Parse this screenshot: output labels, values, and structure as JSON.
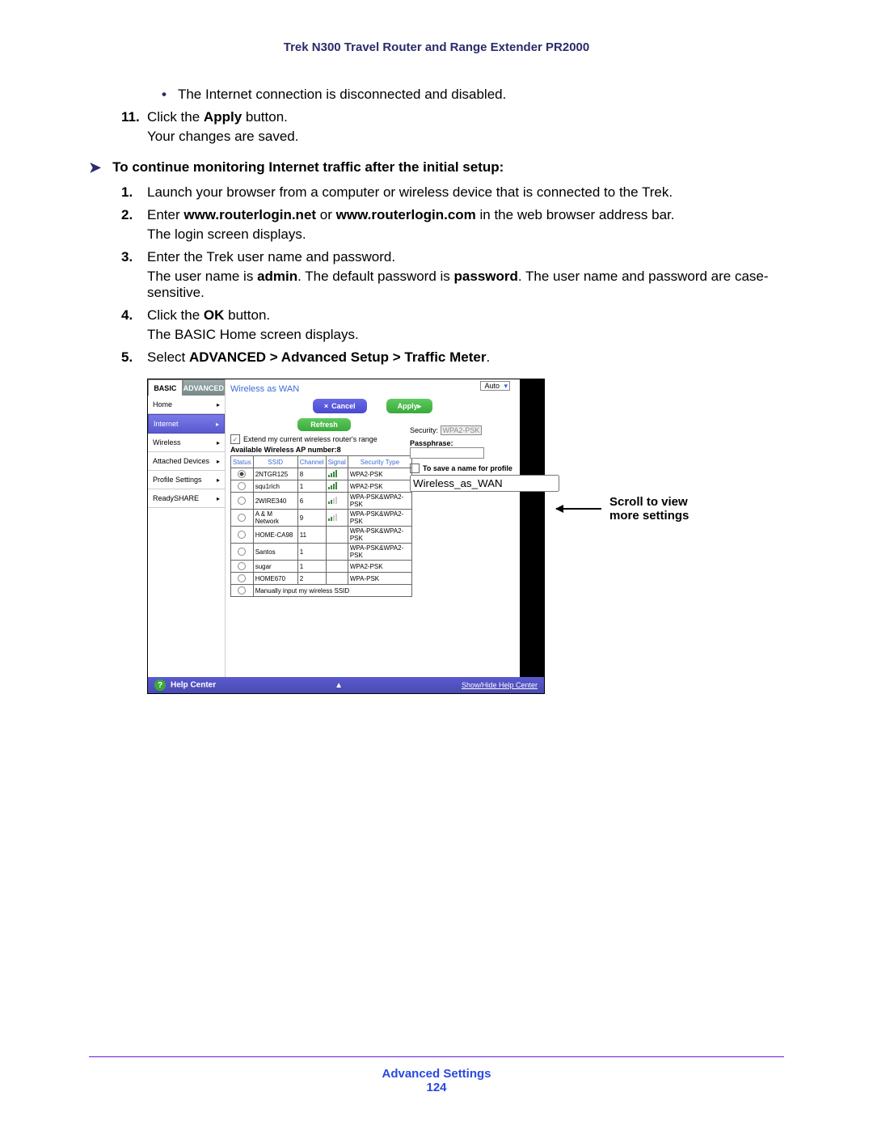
{
  "doc": {
    "title": "Trek N300 Travel Router and Range Extender PR2000",
    "footer_section": "Advanced Settings",
    "page_number": "124"
  },
  "content": {
    "bullet1": "The Internet connection is disconnected and disabled.",
    "step11_num": "11.",
    "step11_a": "Click the ",
    "step11_b": "Apply",
    "step11_c": " button.",
    "step11_follow": "Your changes are saved.",
    "section_head": "To continue monitoring Internet traffic after the initial setup:",
    "s1_num": "1.",
    "s1": "Launch your browser from a computer or wireless device that is connected to the Trek.",
    "s2_num": "2.",
    "s2_a": "Enter ",
    "s2_b": "www.routerlogin.net",
    "s2_c": " or ",
    "s2_d": "www.routerlogin.com",
    "s2_e": " in the web browser address bar.",
    "s2_follow": "The login screen displays.",
    "s3_num": "3.",
    "s3": "Enter the Trek user name and password.",
    "s3_follow_a": "The user name is ",
    "s3_follow_b": "admin",
    "s3_follow_c": ". The default password is ",
    "s3_follow_d": "password",
    "s3_follow_e": ". The user name and password are case-sensitive.",
    "s4_num": "4.",
    "s4_a": "Click the ",
    "s4_b": "OK",
    "s4_c": " button.",
    "s4_follow": "The BASIC Home screen displays.",
    "s5_num": "5.",
    "s5_a": "Select ",
    "s5_b": "ADVANCED > Advanced Setup > Traffic Meter",
    "s5_c": "."
  },
  "annotation": {
    "line1": "Scroll to view",
    "line2": "more settings"
  },
  "screenshot": {
    "auto_label": "Auto",
    "tabs": {
      "basic": "BASIC",
      "advanced": "ADVANCED"
    },
    "sidebar": [
      {
        "label": "Home",
        "active": false
      },
      {
        "label": "Internet",
        "active": true
      },
      {
        "label": "Wireless",
        "active": false
      },
      {
        "label": "Attached Devices",
        "active": false
      },
      {
        "label": "Profile Settings",
        "active": false
      },
      {
        "label": "ReadySHARE",
        "active": false
      }
    ],
    "main_title": "Wireless as WAN",
    "cancel_label": "Cancel",
    "apply_label": "Apply",
    "refresh_label": "Refresh",
    "extend_label": "Extend my current wireless router's range",
    "ap_count_label": "Available Wireless AP number:8",
    "table_headers": {
      "status": "Status",
      "ssid": "SSID",
      "channel": "Channel",
      "signal": "Signal",
      "security": "Security Type"
    },
    "rows": [
      {
        "sel": true,
        "ssid": "2NTGR125",
        "ch": "8",
        "sig": "hi",
        "sec": "WPA2-PSK"
      },
      {
        "sel": false,
        "ssid": "squ1rich",
        "ch": "1",
        "sig": "hi",
        "sec": "WPA2-PSK"
      },
      {
        "sel": false,
        "ssid": "2WIRE340",
        "ch": "6",
        "sig": "lo",
        "sec": "WPA-PSK&WPA2-PSK"
      },
      {
        "sel": false,
        "ssid": "A & M Network",
        "ch": "9",
        "sig": "lo",
        "sec": "WPA-PSK&WPA2-PSK"
      },
      {
        "sel": false,
        "ssid": "HOME-CA98",
        "ch": "11",
        "sig": "",
        "sec": "WPA-PSK&WPA2-PSK"
      },
      {
        "sel": false,
        "ssid": "Santos",
        "ch": "1",
        "sig": "",
        "sec": "WPA-PSK&WPA2-PSK"
      },
      {
        "sel": false,
        "ssid": "sugar",
        "ch": "1",
        "sig": "",
        "sec": "WPA2-PSK"
      },
      {
        "sel": false,
        "ssid": "HOME670",
        "ch": "2",
        "sig": "",
        "sec": "WPA-PSK"
      }
    ],
    "manual_label": "Manually input my wireless SSID",
    "security_label": "Security:",
    "security_value": "WPA2-PSK",
    "passphrase_label": "Passphrase:",
    "save_profile_label": "To save a name for profile",
    "profile_value": "Wireless_as_WAN",
    "helpcenter": "Help Center",
    "show_hide": "Show/Hide Help Center"
  }
}
